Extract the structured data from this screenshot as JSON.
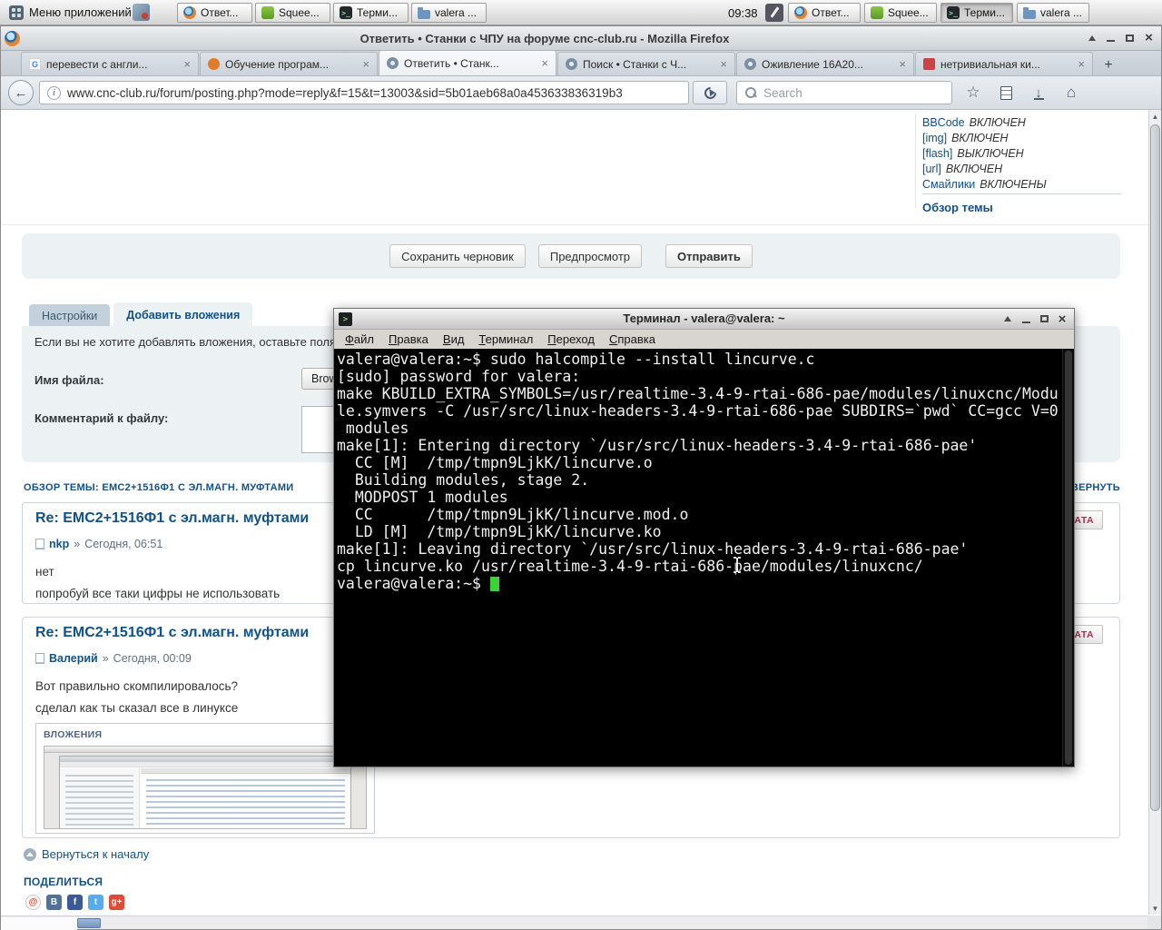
{
  "panel": {
    "menu_label": "Меню приложений",
    "clock": "09:38",
    "taskbar_group1": [
      {
        "label": "Ответ...",
        "icon": "firefox-icon",
        "active": false
      },
      {
        "label": "Squee...",
        "icon": "squeeze-icon",
        "active": false
      },
      {
        "label": "Терми...",
        "icon": "terminal-icon",
        "active": false
      },
      {
        "label": "valera ...",
        "icon": "folder-icon",
        "active": false
      }
    ],
    "taskbar_group2": [
      {
        "label": "Ответ...",
        "icon": "firefox-icon",
        "active": false
      },
      {
        "label": "Squee...",
        "icon": "squeeze-icon",
        "active": false
      },
      {
        "label": "Терми...",
        "icon": "terminal-icon",
        "active": true
      },
      {
        "label": "valera ...",
        "icon": "folder-icon",
        "active": false
      }
    ]
  },
  "browser": {
    "window_title": "Ответить • Станки с ЧПУ на форуме cnc-club.ru - Mozilla Firefox",
    "tabs": [
      {
        "title": "перевести с англи...",
        "icon": "google-favicon",
        "active": false
      },
      {
        "title": "Обучение програм...",
        "icon": "orange-favicon",
        "active": false
      },
      {
        "title": "Ответить • Станк...",
        "icon": "cnc-club-favicon",
        "active": true
      },
      {
        "title": "Поиск • Станки с Ч...",
        "icon": "cnc-club-favicon",
        "active": false
      },
      {
        "title": "Оживление 16А20...",
        "icon": "cnc-club-favicon",
        "active": false
      },
      {
        "title": "нетривиальная ки...",
        "icon": "red-favicon",
        "active": false
      }
    ],
    "url": "www.cnc-club.ru/forum/posting.php?mode=reply&f=15&t=13003&sid=5b01aeb68a0a453633836319b3",
    "search_placeholder": "Search"
  },
  "page": {
    "bbcode_statuses": [
      {
        "link": "BBCode",
        "status": "ВКЛЮЧЕН"
      },
      {
        "link": "[img]",
        "status": "ВКЛЮЧЕН"
      },
      {
        "link": "[flash]",
        "status": "ВЫКЛЮЧЕН"
      },
      {
        "link": "[url]",
        "status": "ВКЛЮЧЕН"
      },
      {
        "link": "Смайлики",
        "status": "ВКЛЮЧЕНЫ"
      }
    ],
    "topic_review_link": "Обзор темы",
    "action_buttons": [
      {
        "label": "Сохранить черновик",
        "bold": false
      },
      {
        "label": "Предпросмотр",
        "bold": false
      },
      {
        "label": "Отправить",
        "bold": true
      }
    ],
    "form_tabs": [
      {
        "label": "Настройки",
        "active": false
      },
      {
        "label": "Добавить вложения",
        "active": true
      }
    ],
    "attachments_hint": "Если вы не хотите добавлять вложения, оставьте поля пустыми.",
    "file_name_label": "Имя файла:",
    "browse_button": "Browse...",
    "file_comment_label": "Комментарий к файлу:",
    "topic_review_header": "ОБЗОР ТЕМЫ: EMC2+1516Ф1 С ЭЛ.МАГН. МУФТАМИ",
    "expand_label": "РАЗВЕРНУТЬ",
    "quote_button": "ЦИТАТА",
    "author_sep": "»",
    "posts": [
      {
        "title": "Re: EMC2+1516Ф1 с эл.магн. муфтами",
        "author": "nkp",
        "date": "Сегодня, 06:51",
        "lines": [
          "нет",
          "попробуй все таки цифры не использовать"
        ]
      },
      {
        "title": "Re: EMC2+1516Ф1 с эл.магн. муфтами",
        "author": "Валерий",
        "date": "Сегодня, 00:09",
        "lines": [
          "Вот правильно скомпилировалось?",
          "сделал как ты сказал все в линуксе"
        ]
      }
    ],
    "attachments_label": "ВЛОЖЕНИЯ",
    "back_to_top": "Вернуться к началу",
    "share_heading": "ПОДЕЛИТЬСЯ",
    "share_icons": [
      {
        "name": "mailru-icon",
        "glyph": "@",
        "bg": "#ffffff",
        "fg": "#e8442a",
        "border": "#c8c8c8",
        "round": true
      },
      {
        "name": "vk-icon",
        "glyph": "B",
        "bg": "#507299",
        "fg": "#ffffff",
        "border": "",
        "round": false
      },
      {
        "name": "facebook-icon",
        "glyph": "f",
        "bg": "#3b5998",
        "fg": "#ffffff",
        "border": "",
        "round": false
      },
      {
        "name": "twitter-icon",
        "glyph": "t",
        "bg": "#55acee",
        "fg": "#ffffff",
        "border": "",
        "round": false
      },
      {
        "name": "googleplus-icon",
        "glyph": "g+",
        "bg": "#dd4b39",
        "fg": "#ffffff",
        "border": "",
        "round": false
      }
    ]
  },
  "terminal_window": {
    "title": "Терминал - valera@valera: ~",
    "menu": [
      "Файл",
      "Правка",
      "Вид",
      "Терминал",
      "Переход",
      "Справка"
    ],
    "cursor_color": "#39d439",
    "lines": [
      "valera@valera:~$ sudo halcompile --install lincurve.c",
      "[sudo] password for valera:",
      "make KBUILD_EXTRA_SYMBOLS=/usr/realtime-3.4-9-rtai-686-pae/modules/linuxcnc/Modu",
      "le.symvers -C /usr/src/linux-headers-3.4-9-rtai-686-pae SUBDIRS=`pwd` CC=gcc V=0",
      " modules",
      "make[1]: Entering directory `/usr/src/linux-headers-3.4-9-rtai-686-pae'",
      "  CC [M]  /tmp/tmpn9LjkK/lincurve.o",
      "  Building modules, stage 2.",
      "  MODPOST 1 modules",
      "  CC      /tmp/tmpn9LjkK/lincurve.mod.o",
      "  LD [M]  /tmp/tmpn9LjkK/lincurve.ko",
      "make[1]: Leaving directory `/usr/src/linux-headers-3.4-9-rtai-686-pae'",
      "cp lincurve.ko /usr/realtime-3.4-9-rtai-686-pae/modules/linuxcnc/",
      "valera@valera:~$ "
    ]
  }
}
